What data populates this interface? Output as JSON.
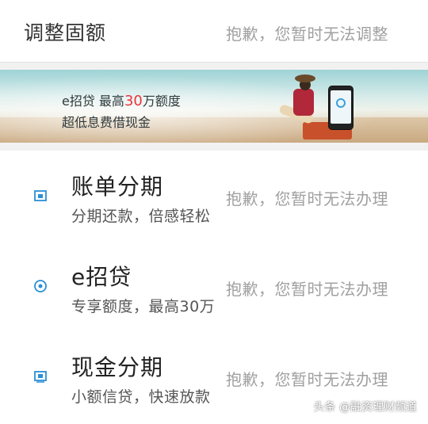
{
  "top": {
    "title": "调整固额",
    "status": "抱歉，您暂时无法调整"
  },
  "banner": {
    "line1_prefix": "e招贷   最高",
    "line1_highlight": "30",
    "line1_suffix": "万额度",
    "line2": "超低息费借现金",
    "phone_label": "e招贷"
  },
  "items": [
    {
      "title": "账单分期",
      "subtitle": "分期还款，倍感轻松",
      "status": "抱歉，您暂时无法办理",
      "icon": "bill-installment-icon"
    },
    {
      "title": "e招贷",
      "subtitle": "专享额度，最高30万",
      "status": "抱歉，您暂时无法办理",
      "icon": "loan-circle-icon"
    },
    {
      "title": "现金分期",
      "subtitle": "小额信贷，快速放款",
      "status": "抱歉，您暂时无法办理",
      "icon": "cash-installment-icon"
    }
  ],
  "watermark": "头条 @融资理财频道",
  "colors": {
    "accent": "#2a8fd6",
    "highlight": "#e8353b",
    "status_gray": "#a0a0a0"
  }
}
